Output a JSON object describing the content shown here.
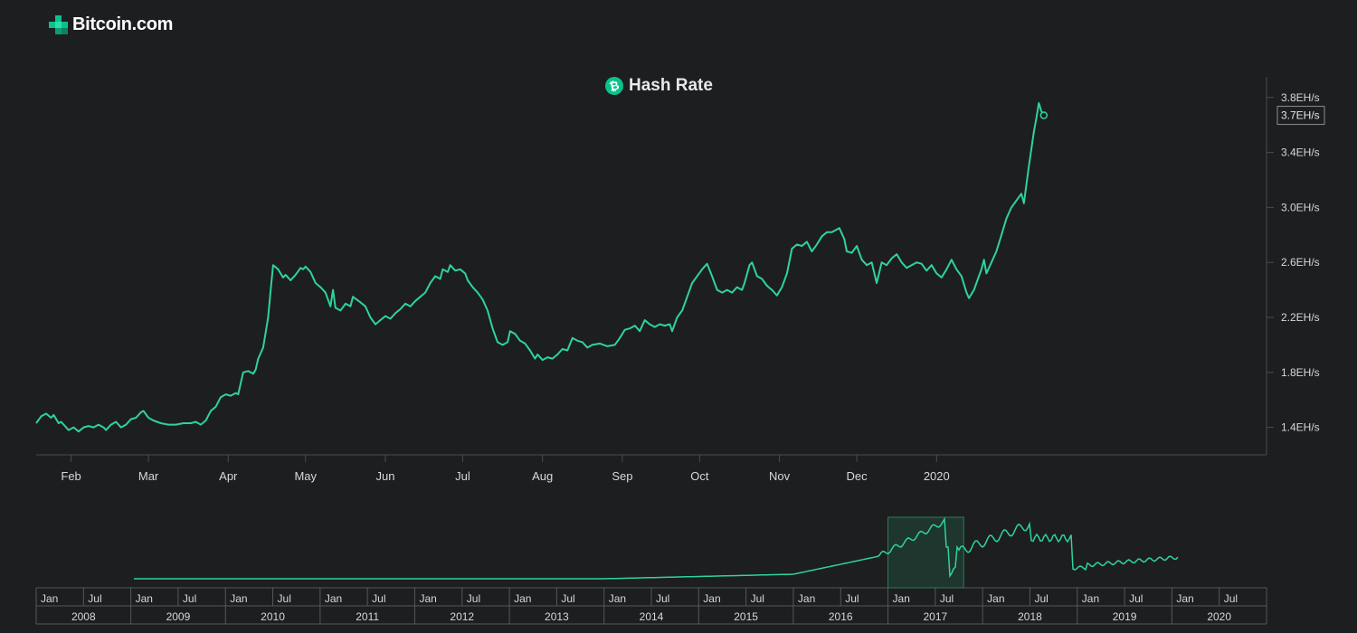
{
  "brand": {
    "name": "Bitcoin.com",
    "icon": "bitcoin-com-logo-icon"
  },
  "colors": {
    "background": "#1d1e20",
    "line": "#2fd39a",
    "axis": "#4a4c50",
    "text": "#d8d8d8",
    "navigator_mask": "#1f4a39"
  },
  "chart_data": {
    "type": "line",
    "title": "Hash Rate",
    "title_icon": "bitcoin-cash-icon",
    "y_unit": "EH/s",
    "ylim": [
      1.2,
      3.95
    ],
    "y_ticks": [
      "1.4EH/s",
      "1.8EH/s",
      "2.2EH/s",
      "2.6EH/s",
      "3.0EH/s",
      "3.4EH/s",
      "3.8EH/s"
    ],
    "y_tick_values": [
      1.4,
      1.8,
      2.2,
      2.6,
      3.0,
      3.4,
      3.8
    ],
    "current_value_label": "3.7EH/s",
    "current_value": 3.67,
    "x_range_days": [
      0,
      380
    ],
    "x_ticks": [
      "Feb",
      "Mar",
      "Apr",
      "May",
      "Jun",
      "Jul",
      "Aug",
      "Sep",
      "Oct",
      "Nov",
      "Dec",
      "2020"
    ],
    "x_tick_days": [
      14,
      45,
      77,
      108,
      140,
      171,
      203,
      235,
      266,
      298,
      329,
      361
    ],
    "series": [
      {
        "points": [
          [
            0,
            1.43
          ],
          [
            2,
            1.48
          ],
          [
            4,
            1.5
          ],
          [
            6,
            1.47
          ],
          [
            7,
            1.49
          ],
          [
            9,
            1.43
          ],
          [
            10,
            1.44
          ],
          [
            12,
            1.4
          ],
          [
            13,
            1.38
          ],
          [
            15,
            1.4
          ],
          [
            17,
            1.37
          ],
          [
            19,
            1.4
          ],
          [
            21,
            1.41
          ],
          [
            23,
            1.4
          ],
          [
            25,
            1.42
          ],
          [
            27,
            1.4
          ],
          [
            28,
            1.38
          ],
          [
            30,
            1.42
          ],
          [
            32,
            1.44
          ],
          [
            34,
            1.4
          ],
          [
            36,
            1.42
          ],
          [
            38,
            1.46
          ],
          [
            40,
            1.47
          ],
          [
            42,
            1.51
          ],
          [
            43,
            1.52
          ],
          [
            45,
            1.47
          ],
          [
            47,
            1.45
          ],
          [
            50,
            1.43
          ],
          [
            53,
            1.42
          ],
          [
            56,
            1.42
          ],
          [
            59,
            1.43
          ],
          [
            62,
            1.43
          ],
          [
            64,
            1.44
          ],
          [
            66,
            1.42
          ],
          [
            68,
            1.45
          ],
          [
            70,
            1.52
          ],
          [
            72,
            1.55
          ],
          [
            74,
            1.62
          ],
          [
            76,
            1.64
          ],
          [
            78,
            1.63
          ],
          [
            80,
            1.65
          ],
          [
            81,
            1.64
          ],
          [
            83,
            1.8
          ],
          [
            85,
            1.81
          ],
          [
            87,
            1.79
          ],
          [
            88,
            1.82
          ],
          [
            89,
            1.9
          ],
          [
            91,
            1.98
          ],
          [
            93,
            2.2
          ],
          [
            94,
            2.4
          ],
          [
            95,
            2.58
          ],
          [
            97,
            2.55
          ],
          [
            99,
            2.49
          ],
          [
            100,
            2.51
          ],
          [
            102,
            2.47
          ],
          [
            104,
            2.51
          ],
          [
            106,
            2.56
          ],
          [
            107,
            2.55
          ],
          [
            108,
            2.57
          ],
          [
            110,
            2.53
          ],
          [
            112,
            2.45
          ],
          [
            114,
            2.42
          ],
          [
            116,
            2.38
          ],
          [
            118,
            2.28
          ],
          [
            119,
            2.4
          ],
          [
            120,
            2.27
          ],
          [
            122,
            2.25
          ],
          [
            124,
            2.3
          ],
          [
            126,
            2.28
          ],
          [
            127,
            2.35
          ],
          [
            130,
            2.31
          ],
          [
            132,
            2.28
          ],
          [
            134,
            2.2
          ],
          [
            136,
            2.15
          ],
          [
            138,
            2.18
          ],
          [
            140,
            2.21
          ],
          [
            142,
            2.19
          ],
          [
            144,
            2.23
          ],
          [
            146,
            2.26
          ],
          [
            148,
            2.3
          ],
          [
            150,
            2.28
          ],
          [
            152,
            2.32
          ],
          [
            154,
            2.35
          ],
          [
            156,
            2.38
          ],
          [
            158,
            2.45
          ],
          [
            160,
            2.5
          ],
          [
            162,
            2.48
          ],
          [
            163,
            2.55
          ],
          [
            165,
            2.53
          ],
          [
            166,
            2.58
          ],
          [
            168,
            2.54
          ],
          [
            170,
            2.55
          ],
          [
            172,
            2.52
          ],
          [
            173,
            2.47
          ],
          [
            175,
            2.42
          ],
          [
            177,
            2.38
          ],
          [
            179,
            2.33
          ],
          [
            181,
            2.25
          ],
          [
            183,
            2.12
          ],
          [
            185,
            2.02
          ],
          [
            187,
            2.0
          ],
          [
            189,
            2.02
          ],
          [
            190,
            2.1
          ],
          [
            192,
            2.08
          ],
          [
            194,
            2.03
          ],
          [
            196,
            2.01
          ],
          [
            198,
            1.96
          ],
          [
            200,
            1.9
          ],
          [
            201,
            1.93
          ],
          [
            203,
            1.89
          ],
          [
            205,
            1.91
          ],
          [
            207,
            1.9
          ],
          [
            209,
            1.93
          ],
          [
            211,
            1.97
          ],
          [
            213,
            1.96
          ],
          [
            215,
            2.05
          ],
          [
            217,
            2.03
          ],
          [
            219,
            2.02
          ],
          [
            221,
            1.98
          ],
          [
            223,
            2.0
          ],
          [
            226,
            2.01
          ],
          [
            229,
            1.99
          ],
          [
            232,
            2.0
          ],
          [
            234,
            2.05
          ],
          [
            236,
            2.11
          ],
          [
            238,
            2.12
          ],
          [
            240,
            2.14
          ],
          [
            242,
            2.1
          ],
          [
            244,
            2.18
          ],
          [
            246,
            2.15
          ],
          [
            248,
            2.13
          ],
          [
            250,
            2.15
          ],
          [
            252,
            2.14
          ],
          [
            254,
            2.15
          ],
          [
            255,
            2.1
          ],
          [
            257,
            2.2
          ],
          [
            259,
            2.25
          ],
          [
            261,
            2.35
          ],
          [
            263,
            2.45
          ],
          [
            265,
            2.5
          ],
          [
            267,
            2.55
          ],
          [
            269,
            2.59
          ],
          [
            271,
            2.5
          ],
          [
            273,
            2.4
          ],
          [
            275,
            2.38
          ],
          [
            277,
            2.4
          ],
          [
            279,
            2.38
          ],
          [
            281,
            2.42
          ],
          [
            283,
            2.4
          ],
          [
            284,
            2.45
          ],
          [
            286,
            2.58
          ],
          [
            287,
            2.6
          ],
          [
            289,
            2.5
          ],
          [
            291,
            2.48
          ],
          [
            293,
            2.43
          ],
          [
            295,
            2.4
          ],
          [
            297,
            2.36
          ],
          [
            299,
            2.42
          ],
          [
            301,
            2.52
          ],
          [
            303,
            2.7
          ],
          [
            305,
            2.73
          ],
          [
            307,
            2.72
          ],
          [
            309,
            2.75
          ],
          [
            311,
            2.68
          ],
          [
            313,
            2.73
          ],
          [
            315,
            2.79
          ],
          [
            317,
            2.82
          ],
          [
            319,
            2.82
          ],
          [
            321,
            2.84
          ],
          [
            322,
            2.85
          ],
          [
            324,
            2.77
          ],
          [
            325,
            2.68
          ],
          [
            327,
            2.67
          ],
          [
            329,
            2.72
          ],
          [
            331,
            2.62
          ],
          [
            333,
            2.58
          ],
          [
            335,
            2.6
          ],
          [
            337,
            2.45
          ],
          [
            339,
            2.6
          ],
          [
            341,
            2.58
          ],
          [
            343,
            2.63
          ],
          [
            345,
            2.66
          ],
          [
            347,
            2.6
          ],
          [
            349,
            2.56
          ],
          [
            351,
            2.58
          ],
          [
            353,
            2.6
          ],
          [
            355,
            2.59
          ],
          [
            357,
            2.54
          ],
          [
            359,
            2.58
          ],
          [
            361,
            2.52
          ],
          [
            363,
            2.49
          ],
          [
            365,
            2.55
          ],
          [
            367,
            2.62
          ],
          [
            369,
            2.55
          ],
          [
            371,
            2.5
          ],
          [
            373,
            2.38
          ],
          [
            374,
            2.34
          ],
          [
            376,
            2.4
          ],
          [
            378,
            2.5
          ],
          [
            379,
            2.55
          ],
          [
            380,
            2.62
          ],
          [
            381,
            2.52
          ],
          [
            383,
            2.6
          ],
          [
            385,
            2.68
          ],
          [
            387,
            2.8
          ],
          [
            389,
            2.92
          ],
          [
            391,
            3.0
          ],
          [
            393,
            3.05
          ],
          [
            395,
            3.1
          ],
          [
            396,
            3.03
          ],
          [
            398,
            3.3
          ],
          [
            400,
            3.55
          ],
          [
            401,
            3.65
          ],
          [
            402,
            3.76
          ],
          [
            403,
            3.7
          ],
          [
            404,
            3.67
          ]
        ]
      }
    ],
    "navigator": {
      "year_labels": [
        "2008",
        "2009",
        "2010",
        "2011",
        "2012",
        "2013",
        "2014",
        "2015",
        "2016",
        "2017",
        "2018",
        "2019",
        "2020"
      ],
      "half_labels": [
        "Jan",
        "Jul"
      ],
      "selected_range_years": [
        2017.0,
        2017.8
      ]
    }
  }
}
